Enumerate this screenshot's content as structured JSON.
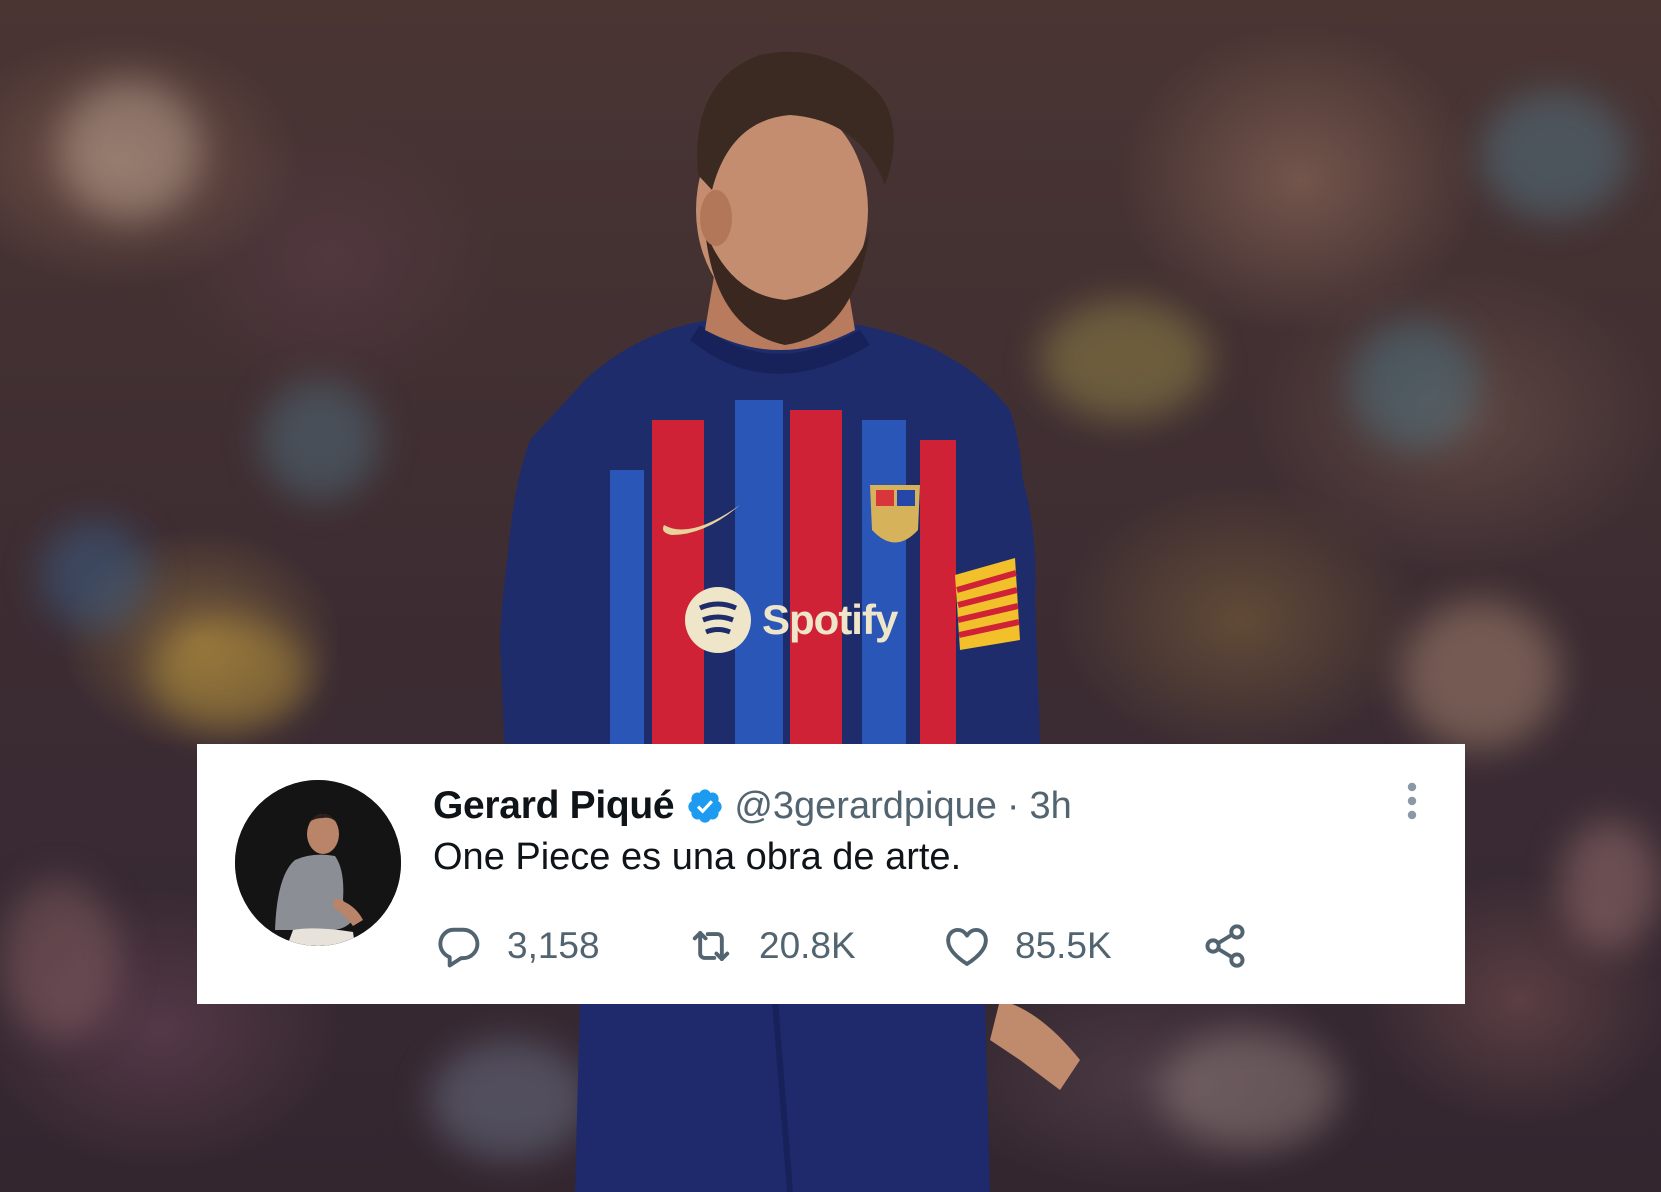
{
  "tweet": {
    "display_name": "Gerard Piqué",
    "handle": "@3gerardpique",
    "separator": "·",
    "time": "3h",
    "text": "One Piece es una obra de arte.",
    "stats": {
      "replies": "3,158",
      "retweets": "20.8K",
      "likes": "85.5K"
    },
    "icons": {
      "verified": "verified-badge-icon",
      "more": "more-options-icon",
      "reply": "reply-icon",
      "retweet": "retweet-icon",
      "like": "heart-icon",
      "share": "share-icon"
    },
    "colors": {
      "verified": "#1d9bf0",
      "text": "#0f1419",
      "secondary": "#536471"
    }
  },
  "photo": {
    "jersey_sponsor": "Spotify"
  }
}
